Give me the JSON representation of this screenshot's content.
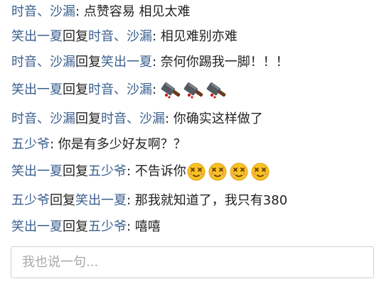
{
  "comments": [
    {
      "user": "时音、沙漏",
      "reply_word": "",
      "reply_to": "",
      "text": ": 点赞容易 相见太难",
      "emoji": []
    },
    {
      "user": "笑出一夏",
      "reply_word": "回复",
      "reply_to": "时音、沙漏",
      "text": ": 相见难别亦难",
      "emoji": []
    },
    {
      "user": "时音、沙漏",
      "reply_word": "回复",
      "reply_to": "笑出一夏",
      "text": ": 奈何你踢我一脚！！！",
      "emoji": []
    },
    {
      "user": "笑出一夏",
      "reply_word": "回复",
      "reply_to": "时音、沙漏",
      "text": ":",
      "emoji": [
        "cleaver-knife-emoji",
        "cleaver-knife-emoji",
        "cleaver-knife-emoji"
      ]
    },
    {
      "user": "时音、沙漏",
      "reply_word": "回复",
      "reply_to": "时音、沙漏",
      "text": ": 你确实这样做了",
      "emoji": []
    },
    {
      "user": "五少爷",
      "reply_word": "",
      "reply_to": "",
      "text": ": 你是有多少好友啊？？",
      "emoji": []
    },
    {
      "user": "笑出一夏",
      "reply_word": "回复",
      "reply_to": "五少爷",
      "text": ": 不告诉你",
      "emoji": [
        "dizzy-face-emoji",
        "dizzy-face-emoji",
        "dizzy-face-emoji",
        "dizzy-face-emoji"
      ]
    },
    {
      "user": "五少爷",
      "reply_word": "回复",
      "reply_to": "笑出一夏",
      "text": ": 那我就知道了，我只有380",
      "emoji": []
    },
    {
      "user": "笑出一夏",
      "reply_word": "回复",
      "reply_to": "五少爷",
      "text": ": 嘻嘻",
      "emoji": []
    }
  ],
  "comment_input": {
    "placeholder": "我也说一句..."
  },
  "colors": {
    "username": "#3a5f8f",
    "text": "#222222",
    "placeholder": "#a8a8a8",
    "input_border": "#d0d0d0"
  }
}
